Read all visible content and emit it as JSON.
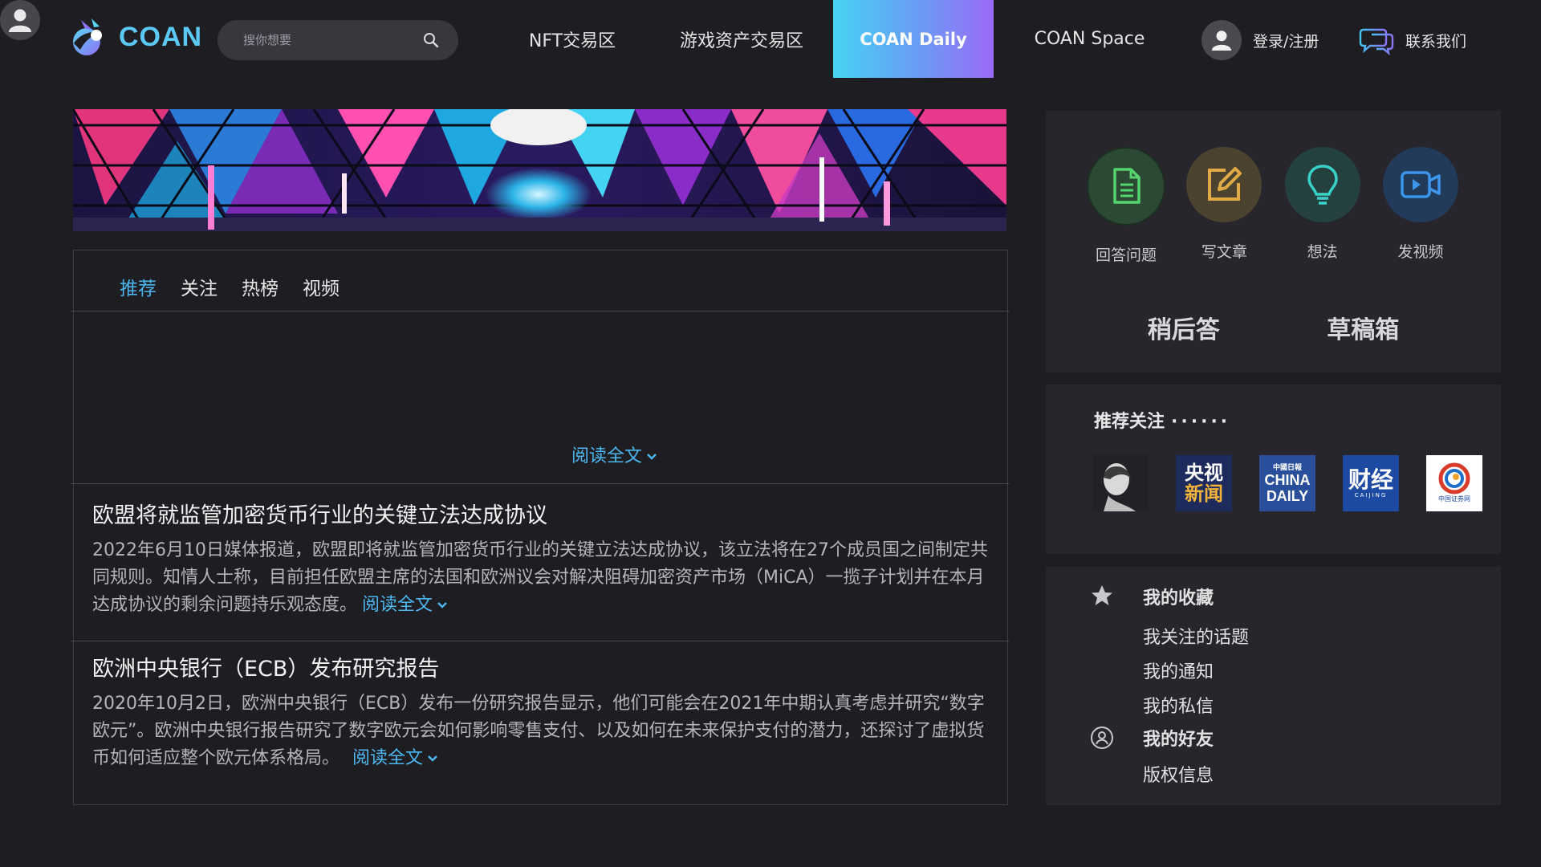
{
  "header": {
    "logo_text": "COAN",
    "search": {
      "placeholder": "搜你想要"
    },
    "nav": [
      {
        "label": "NFT交易区"
      },
      {
        "label": "游戏资产交易区"
      },
      {
        "label": "COAN Daily",
        "active": true
      },
      {
        "label": "COAN Space"
      }
    ],
    "login_label": "登录/注册",
    "contact_label": "联系我们"
  },
  "feed": {
    "tabs": [
      {
        "label": "推荐",
        "active": true
      },
      {
        "label": "关注"
      },
      {
        "label": "热榜"
      },
      {
        "label": "视频"
      }
    ],
    "readmore_label": "阅读全文",
    "articles": [
      {
        "title": "欧盟将就监管加密货币行业的关键立法达成协议",
        "body": "2022年6月10日媒体报道，欧盟即将就监管加密货币行业的关键立法达成协议，该立法将在27个成员国之间制定共同规则。知情人士称，目前担任欧盟主席的法国和欧洲议会对解决阻碍加密资产市场（MiCA）一揽子计划并在本月达成协议的剩余问题持乐观态度。"
      },
      {
        "title": "欧洲中央银行（ECB）发布研究报告",
        "body": "2020年10月2日，欧洲中央银行（ECB）发布一份研究报告显示，他们可能会在2021年中期认真考虑并研究“数字欧元”。欧洲中央银行报告研究了数字欧元会如何影响零售支付、以及如何在未来保护支付的潜力，还探讨了虚拟货币如何适应整个欧元体系格局。"
      }
    ]
  },
  "sidebar": {
    "actions": [
      {
        "label": "回答问题",
        "icon": "document-icon",
        "color": "#52c46b"
      },
      {
        "label": "写文章",
        "icon": "edit-icon",
        "color": "#d4a74a"
      },
      {
        "label": "想法",
        "icon": "lightbulb-icon",
        "color": "#35c9c1"
      },
      {
        "label": "发视频",
        "icon": "video-icon",
        "color": "#3b92e6"
      }
    ],
    "later_answer": "稍后答",
    "drafts": "草稿箱",
    "recommend_title": "推荐关注",
    "recommend_dots": "······",
    "recommend_logos": [
      {
        "name": "portrait"
      },
      {
        "name": "cctv-news",
        "line1": "央视",
        "line2": "新闻"
      },
      {
        "name": "china-daily",
        "top": "中國日報",
        "line1": "CHINA",
        "line2": "DAILY"
      },
      {
        "name": "caijing",
        "line1": "财经",
        "sub": "CAIJING"
      },
      {
        "name": "cnstock",
        "sub": "中国证券网"
      }
    ],
    "menu": [
      {
        "label": "我的收藏",
        "bold": true,
        "icon": "star-icon"
      },
      {
        "label": "我关注的话题"
      },
      {
        "label": "我的通知"
      },
      {
        "label": "我的私信"
      },
      {
        "label": "我的好友",
        "bold": true,
        "icon": "friends-icon"
      },
      {
        "label": "版权信息"
      }
    ]
  },
  "colors": {
    "accent": "#4bb5ef",
    "background": "#1e1d22",
    "panel": "#27262c",
    "active_gradient": [
      "#46d3f3",
      "#9a6af7"
    ]
  }
}
